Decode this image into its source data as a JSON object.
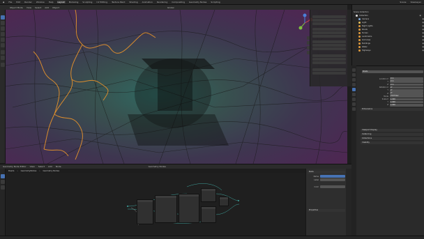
{
  "menu": {
    "items": [
      "File",
      "Edit",
      "Render",
      "Window",
      "Help"
    ],
    "workspaces": [
      "Layout",
      "Modeling",
      "Sculpting",
      "UV Editing",
      "Texture Paint",
      "Shading",
      "Animation",
      "Rendering",
      "Compositing",
      "Geometry Nodes",
      "Scripting"
    ],
    "active_workspace": "Layout",
    "scene": "Scene",
    "view_layer": "ViewLayer"
  },
  "viewport": {
    "mode": "Object Mode",
    "menus": [
      "View",
      "Select",
      "Add",
      "Object"
    ],
    "orientation": "Global"
  },
  "outliner": {
    "title": "Scene Collection",
    "rows": [
      {
        "label": "Collection",
        "color": "#e0e0e0"
      },
      {
        "label": "Camera",
        "color": "#7fa8d9"
      },
      {
        "label": "Light",
        "color": "#e6c25a"
      },
      {
        "label": "Night Lights",
        "color": "#e09a3c"
      },
      {
        "label": "Roads",
        "color": "#e09a3c"
      },
      {
        "label": "Terrain",
        "color": "#e09a3c"
      },
      {
        "label": "Landmarks",
        "color": "#e09a3c"
      },
      {
        "label": "Grid Area",
        "color": "#e09a3c"
      },
      {
        "label": "Buildings",
        "color": "#e09a3c"
      },
      {
        "label": "Water",
        "color": "#e09a3c"
      },
      {
        "label": "Highways",
        "color": "#e09a3c"
      }
    ]
  },
  "properties": {
    "object_name": "Roads",
    "sections": [
      "Dimensions",
      "Viewport Display",
      "Instancing",
      "Collections",
      "Visibility"
    ],
    "rows": [
      {
        "label": "Location X",
        "value": "0 m"
      },
      {
        "label": "Y",
        "value": "0 m"
      },
      {
        "label": "Z",
        "value": "0 m"
      },
      {
        "label": "Rotation X",
        "value": "0°"
      },
      {
        "label": "Y",
        "value": "0°"
      },
      {
        "label": "Z",
        "value": "0°"
      },
      {
        "label": "Mode",
        "value": "XYZ Euler"
      },
      {
        "label": "Scale X",
        "value": "1.000"
      },
      {
        "label": "Y",
        "value": "1.000"
      },
      {
        "label": "Z",
        "value": "1.000"
      }
    ]
  },
  "node_editor": {
    "editor": "Geometry Node Editor",
    "menus": [
      "View",
      "Select",
      "Add",
      "Node"
    ],
    "tree_name": "Geometry Nodes",
    "breadcrumb": [
      "Roads",
      "GeometryNodes",
      "Geometry Nodes"
    ],
    "sidebar_sections": [
      "Node",
      "Properties"
    ],
    "sidebar_items": [
      "Name",
      "Label",
      "Color"
    ]
  },
  "colors": {
    "accent": "#4772b3",
    "road_highlight": "#e09a3c",
    "background": "#1d1d1d"
  }
}
